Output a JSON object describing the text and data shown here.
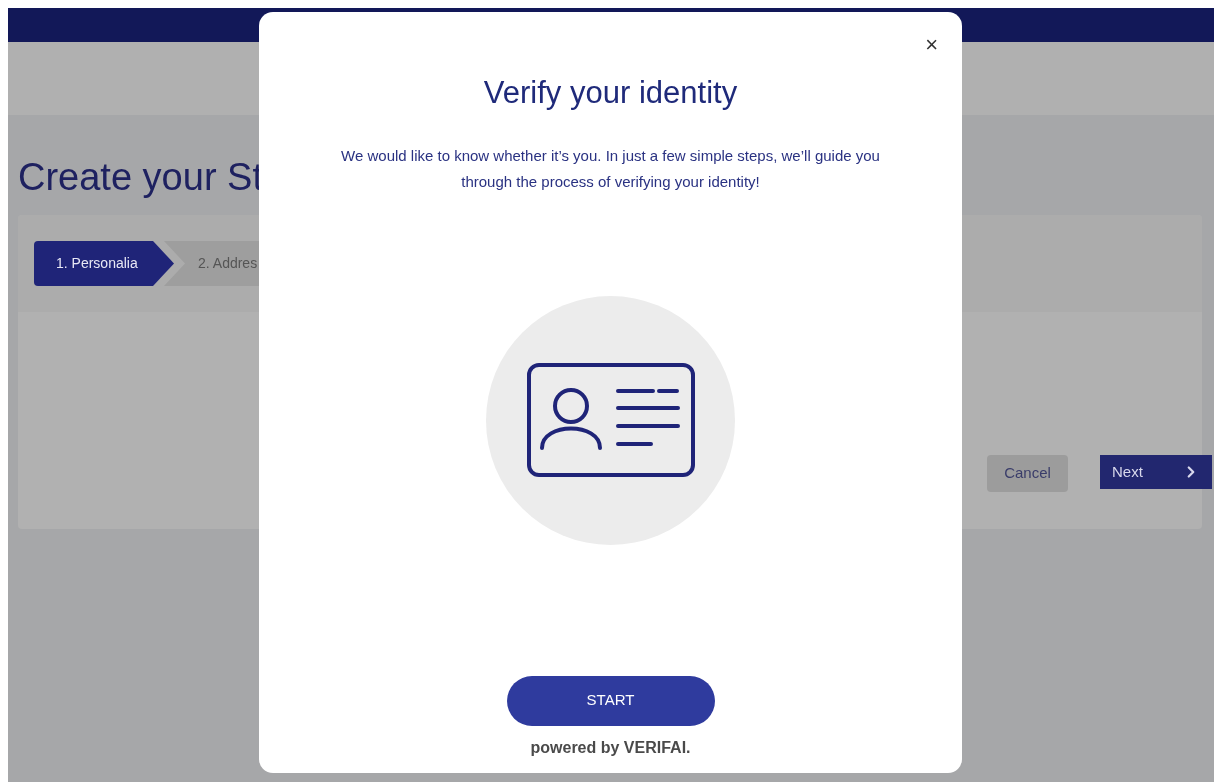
{
  "page": {
    "title": "Create your St",
    "steps": [
      {
        "label": "1. Personalia",
        "selected": true
      },
      {
        "label": "2. Addres",
        "selected": false
      }
    ],
    "buttons": {
      "cancel": "Cancel",
      "next": "Next"
    }
  },
  "modal": {
    "close": "×",
    "title": "Verify your identity",
    "description": "We would like to know whether it’s you. In just a few simple steps, we’ll guide you through the process of verifying your identity!",
    "start": "START",
    "footer": "powered by VERIFAI."
  }
}
